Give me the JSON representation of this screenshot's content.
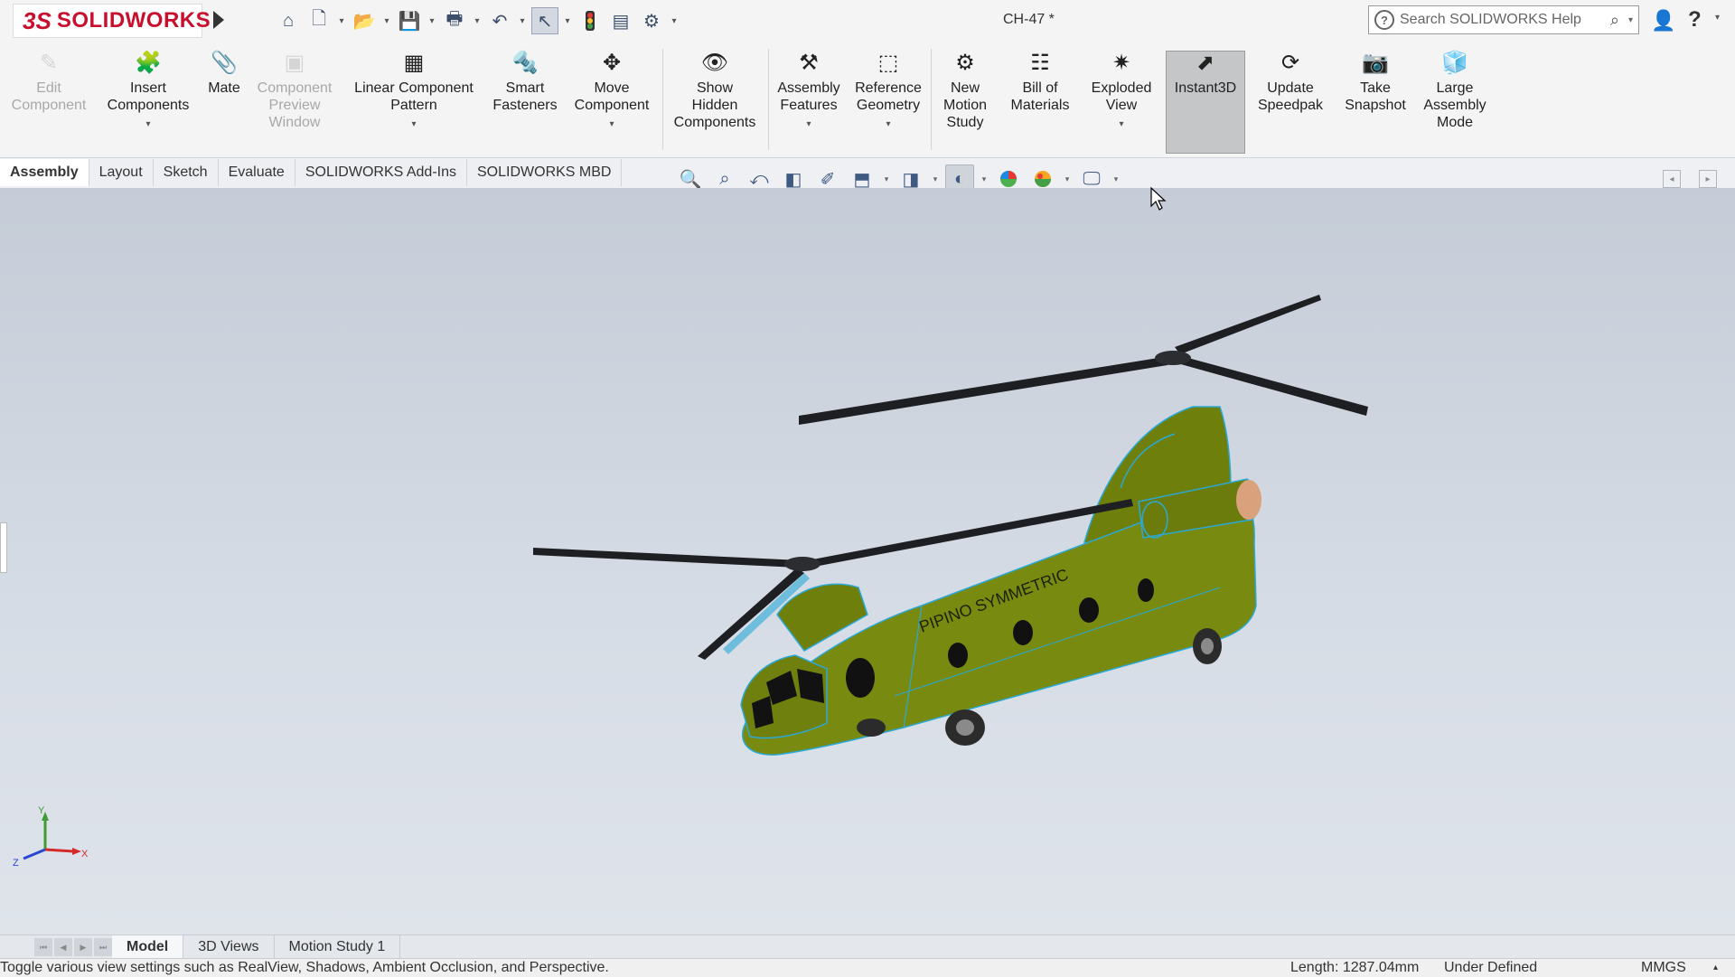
{
  "app": {
    "logo_ds": "3S",
    "logo_brand": "SOLIDWORKS"
  },
  "document": {
    "title": "CH-47 *"
  },
  "search": {
    "placeholder": "Search SOLIDWORKS Help"
  },
  "ribbon": {
    "edit_component": [
      "Edit",
      "Component"
    ],
    "insert_components": [
      "Insert",
      "Components"
    ],
    "mate": [
      "Mate"
    ],
    "component_preview": [
      "Component",
      "Preview",
      "Window"
    ],
    "linear_pattern": [
      "Linear Component",
      "Pattern"
    ],
    "smart_fasteners": [
      "Smart",
      "Fasteners"
    ],
    "move_component": [
      "Move",
      "Component"
    ],
    "show_hidden": [
      "Show",
      "Hidden",
      "Components"
    ],
    "assembly_features": [
      "Assembly",
      "Features"
    ],
    "reference_geometry": [
      "Reference",
      "Geometry"
    ],
    "new_motion_study": [
      "New",
      "Motion",
      "Study"
    ],
    "bill_of_materials": [
      "Bill of",
      "Materials"
    ],
    "exploded_view": [
      "Exploded",
      "View"
    ],
    "instant3d": [
      "Instant3D"
    ],
    "update_speedpak": [
      "Update",
      "Speedpak"
    ],
    "take_snapshot": [
      "Take",
      "Snapshot"
    ],
    "large_assembly": [
      "Large",
      "Assembly",
      "Mode"
    ]
  },
  "command_tabs": [
    "Assembly",
    "Layout",
    "Sketch",
    "Evaluate",
    "SOLIDWORKS Add-Ins",
    "SOLIDWORKS MBD"
  ],
  "model": {
    "fuselage_text": "PIPINO SYMMETRIC"
  },
  "triad": {
    "x": "X",
    "y": "Y",
    "z": "Z"
  },
  "bottom_tabs": [
    "Model",
    "3D Views",
    "Motion Study 1"
  ],
  "status": {
    "message": "Toggle various view settings such as RealView, Shadows, Ambient Occlusion, and Perspective.",
    "length": "Length: 1287.04mm",
    "definition": "Under Defined",
    "units": "MMGS"
  },
  "colors": {
    "brand": "#c8102e",
    "model": "#7a8a12",
    "edges": "#2aa9d6",
    "background": "#ccd3dd"
  }
}
